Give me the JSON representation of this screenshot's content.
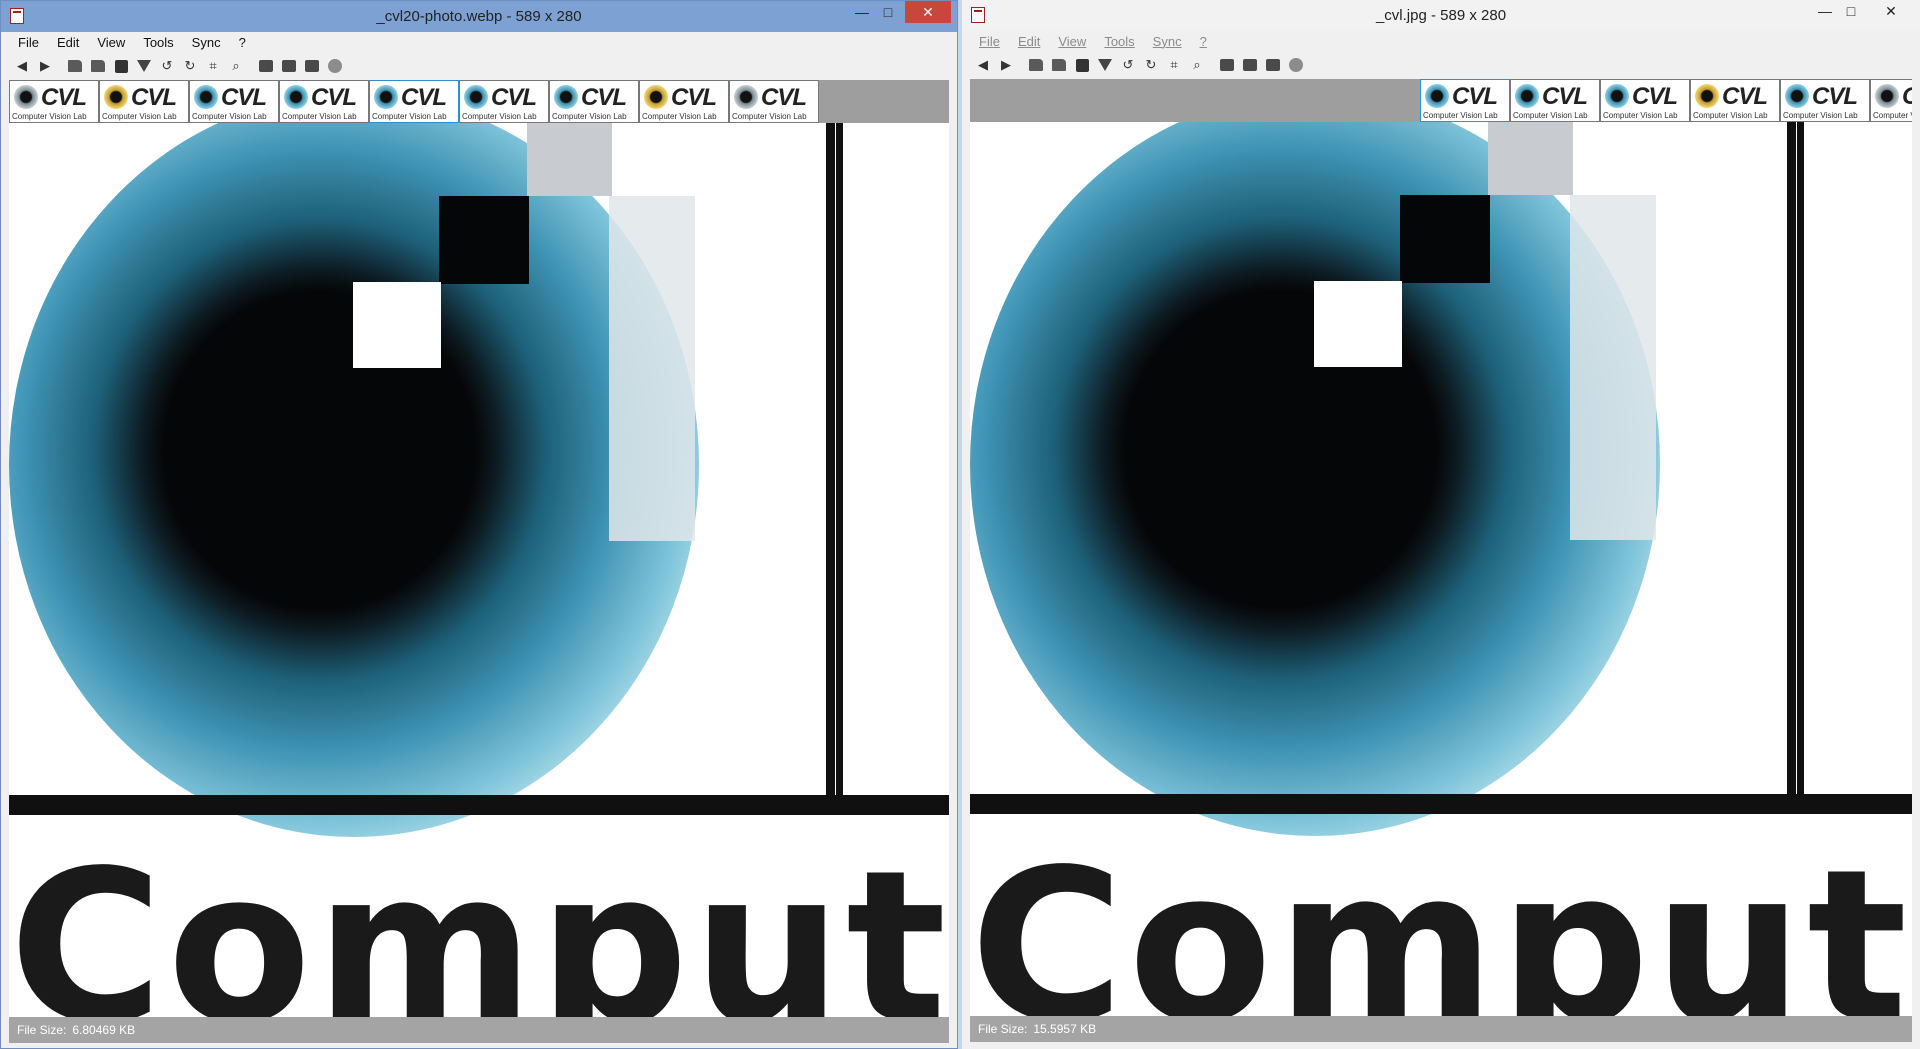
{
  "left_window": {
    "title": "_cvl20-photo.webp - 589 x 280",
    "menu": [
      "File",
      "Edit",
      "View",
      "Tools",
      "Sync",
      "?"
    ],
    "controls": {
      "minimize": "—",
      "maximize": "□",
      "close": "✕"
    },
    "thumbnails": [
      {
        "text": "CVL",
        "sub": "Computer Vision Lab",
        "eye": "grey",
        "selected": false
      },
      {
        "text": "CVL",
        "sub": "Computer Vision Lab",
        "eye": "gold",
        "selected": false
      },
      {
        "text": "CVL",
        "sub": "Computer Vision Lab",
        "eye": "blue",
        "selected": false
      },
      {
        "text": "CVL",
        "sub": "Computer Vision Lab",
        "eye": "blue",
        "selected": false
      },
      {
        "text": "CVL",
        "sub": "Computer Vision Lab",
        "eye": "blue",
        "selected": true
      },
      {
        "text": "CVL",
        "sub": "Computer Vision Lab",
        "eye": "blue",
        "selected": false
      },
      {
        "text": "CVL",
        "sub": "Computer Vision Lab",
        "eye": "blue",
        "selected": false
      },
      {
        "text": "CVL",
        "sub": "Computer Vision Lab",
        "eye": "gold",
        "selected": false
      },
      {
        "text": "CVL",
        "sub": "Computer Vision Lab",
        "eye": "grey",
        "selected": false
      }
    ],
    "big_text": "Compute",
    "status": {
      "label": "File Size:",
      "value": "6.80469 KB"
    }
  },
  "right_window": {
    "title": "_cvl.jpg - 589 x 280",
    "menu": [
      "File",
      "Edit",
      "View",
      "Tools",
      "Sync",
      "?"
    ],
    "controls": {
      "minimize": "—",
      "maximize": "□",
      "close": "✕"
    },
    "thumbnails": [
      {
        "text": "CVL",
        "sub": "Computer Vision Lab",
        "eye": "blue",
        "selected": true
      },
      {
        "text": "CVL",
        "sub": "Computer Vision Lab",
        "eye": "blue",
        "selected": false
      },
      {
        "text": "CVL",
        "sub": "Computer Vision Lab",
        "eye": "blue",
        "selected": false
      },
      {
        "text": "CVL",
        "sub": "Computer Vision Lab",
        "eye": "gold",
        "selected": false
      },
      {
        "text": "CVL",
        "sub": "Computer Vision Lab",
        "eye": "blue",
        "selected": false
      },
      {
        "text": "CVL",
        "sub": "Computer Vision Lab",
        "eye": "grey",
        "selected": false
      }
    ],
    "big_text": "Compute",
    "status": {
      "label": "File Size:",
      "value": "15.5957 KB"
    }
  },
  "toolbar_icons": [
    "back-arrow-icon",
    "forward-arrow-icon",
    "open-folder-icon",
    "folder-icon",
    "save-icon",
    "filter-icon",
    "rotate-left-icon",
    "rotate-right-icon",
    "crop-icon",
    "zoom-icon",
    "fit-window-icon",
    "fit-width-icon",
    "actual-size-icon",
    "globe-icon"
  ]
}
